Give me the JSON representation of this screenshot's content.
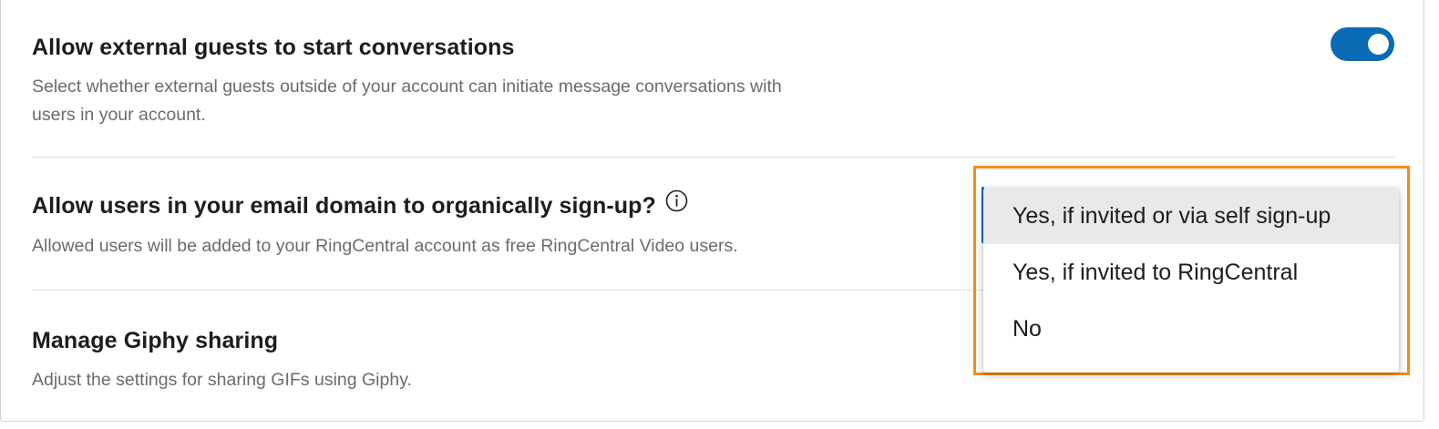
{
  "settings": [
    {
      "title": "Allow external guests to start conversations",
      "description_line1": "Select whether external guests outside of your account can initiate message conversations with",
      "description_line2": "users in your account.",
      "toggle_state": "on"
    },
    {
      "title": "Allow users in your email domain to organically sign-up?",
      "description": "Allowed users will be added to your RingCentral account as free RingCentral Video users.",
      "info_icon": "info-circle-icon"
    },
    {
      "title": "Manage Giphy sharing",
      "description": "Adjust the settings for sharing GIFs using Giphy."
    }
  ],
  "dropdown": {
    "selected": "Yes, if invited or via self sign-up",
    "options": [
      "Yes, if invited or via self sign-up",
      "Yes, if invited to RingCentral",
      "No"
    ]
  },
  "colors": {
    "toggle_on": "#0a6bb3",
    "highlight_border": "#f28c1e",
    "selected_option_bg": "#e9e9e9"
  }
}
